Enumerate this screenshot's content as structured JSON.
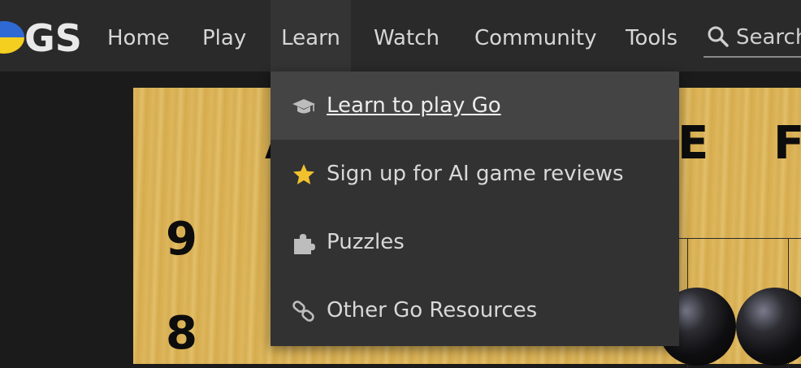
{
  "brand": {
    "logo_text": "GS"
  },
  "nav": {
    "items": [
      {
        "label": "Home"
      },
      {
        "label": "Play"
      },
      {
        "label": "Learn"
      },
      {
        "label": "Watch"
      },
      {
        "label": "Community"
      },
      {
        "label": "Tools"
      }
    ],
    "active": "Learn",
    "search_placeholder": "Search"
  },
  "learn_menu": {
    "items": [
      {
        "label": "Learn to play Go",
        "icon": "graduation-cap-icon",
        "highlighted": true
      },
      {
        "label": "Sign up for AI game reviews",
        "icon": "star-icon",
        "icon_color": "#f2c12e"
      },
      {
        "label": "Puzzles",
        "icon": "puzzle-icon"
      },
      {
        "label": "Other Go Resources",
        "icon": "link-icon"
      }
    ]
  },
  "board": {
    "column_labels": [
      "A",
      "E",
      "F"
    ],
    "row_labels": [
      "9",
      "8"
    ]
  },
  "colors": {
    "topbar": "#2a2a2a",
    "dropdown": "#323232",
    "highlight": "#444444",
    "board_wood": "#ddb75e"
  }
}
